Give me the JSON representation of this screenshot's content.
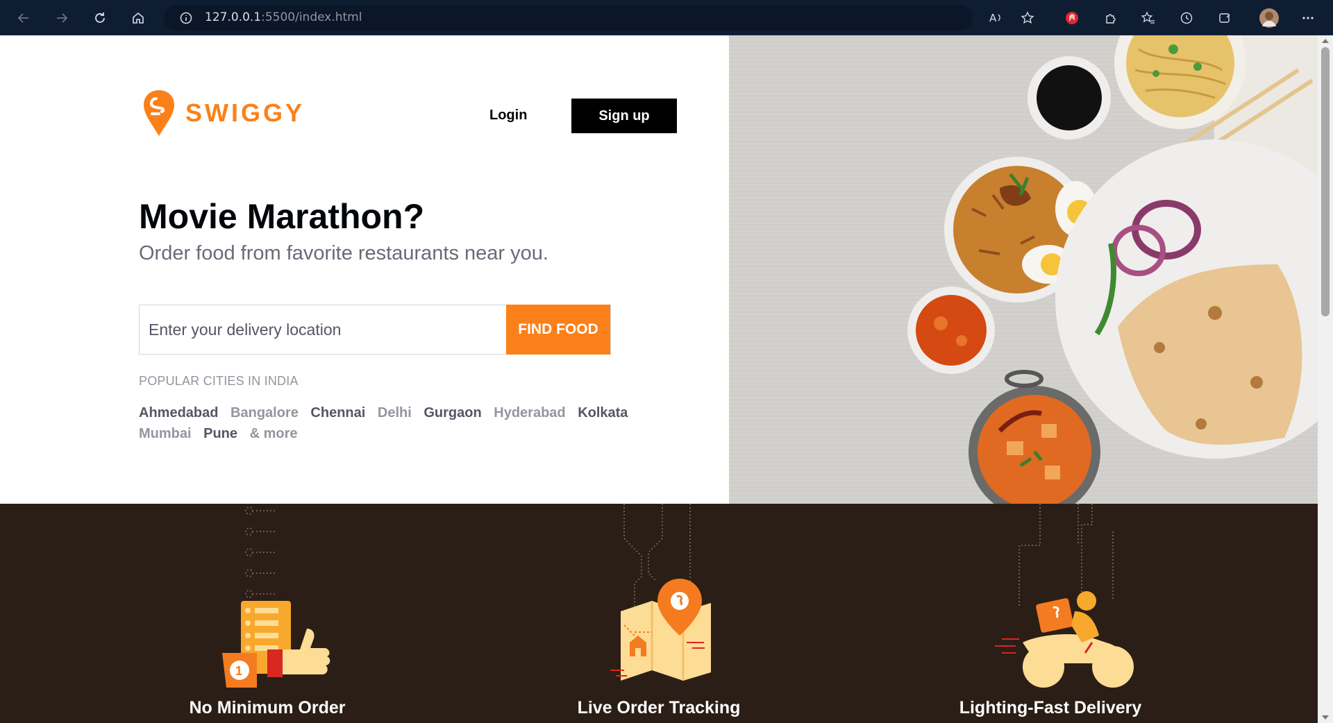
{
  "browser": {
    "url_host": "127.0.0.1",
    "url_rest": ":5500/index.html"
  },
  "brand": {
    "name": "SWIGGY",
    "accent": "#fc8019"
  },
  "header": {
    "login_label": "Login",
    "signup_label": "Sign up"
  },
  "hero": {
    "headline": "Movie Marathon?",
    "subline": "Order food from favorite restaurants near you.",
    "search_placeholder": "Enter your delivery location",
    "find_button": "FIND FOOD"
  },
  "cities": {
    "title": "POPULAR CITIES IN INDIA",
    "items": [
      "Ahmedabad",
      "Bangalore",
      "Chennai",
      "Delhi",
      "Gurgaon",
      "Hyderabad",
      "Kolkata",
      "Mumbai",
      "Pune",
      "& more"
    ]
  },
  "features": [
    {
      "title": "No Minimum Order"
    },
    {
      "title": "Live Order Tracking"
    },
    {
      "title": "Lighting-Fast Delivery"
    }
  ]
}
